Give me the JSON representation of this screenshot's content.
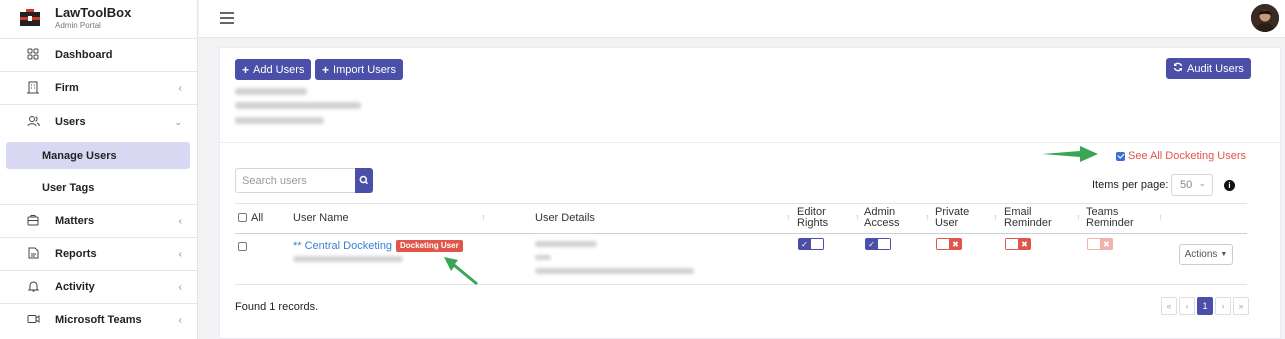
{
  "brand": {
    "name": "LawToolBox",
    "subtitle": "Admin Portal"
  },
  "sidebar": {
    "items": [
      {
        "label": "Dashboard",
        "icon": "grid-icon"
      },
      {
        "label": "Firm",
        "icon": "building-icon"
      },
      {
        "label": "Users",
        "icon": "users-icon"
      },
      {
        "label": "Manage Users",
        "active": true
      },
      {
        "label": "User Tags"
      },
      {
        "label": "Matters",
        "icon": "briefcase-icon"
      },
      {
        "label": "Reports",
        "icon": "report-icon"
      },
      {
        "label": "Activity",
        "icon": "bell-icon"
      },
      {
        "label": "Microsoft Teams",
        "icon": "video-icon"
      }
    ]
  },
  "toolbar": {
    "add_users": "Add Users",
    "import_users": "Import Users",
    "audit_users": "Audit Users"
  },
  "search": {
    "placeholder": "Search users"
  },
  "docketing": {
    "label": "See All Docketing Users",
    "checked": true
  },
  "paging": {
    "items_per_page_label": "Items per page:",
    "items_per_page": "50"
  },
  "table": {
    "headers": {
      "all": "All",
      "user_name": "User Name",
      "user_details": "User Details",
      "editor_rights": [
        "Editor",
        "Rights"
      ],
      "admin_access": [
        "Admin",
        "Access"
      ],
      "private_user": [
        "Private",
        "User"
      ],
      "email_reminder": [
        "Email",
        "Reminder"
      ],
      "teams_reminder": [
        "Teams",
        "Reminder"
      ]
    },
    "row": {
      "user_name": "** Central Docketing",
      "badge": "Docketing User",
      "editor_rights": true,
      "admin_access": true,
      "private_user": false,
      "email_reminder": false,
      "teams_reminder": false,
      "actions_label": "Actions"
    }
  },
  "footer": {
    "found": "Found 1 records.",
    "current_page": "1"
  },
  "colors": {
    "primary": "#4b4fa8",
    "danger": "#e0564b",
    "link": "#3a7fd1",
    "annotation_arrow": "#3aa655"
  }
}
